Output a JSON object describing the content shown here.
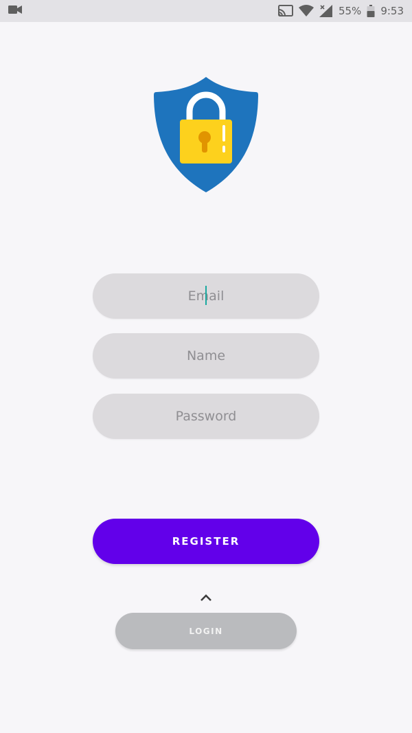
{
  "status_bar": {
    "left_icon": "video-camera-icon",
    "icons": [
      "cast-icon",
      "wifi-icon",
      "signal-icon",
      "battery-icon"
    ],
    "battery": "55%",
    "time": "9:53"
  },
  "logo": {
    "icon": "shield-lock-icon",
    "colors": {
      "shield": "#1e74bd",
      "lock_body": "#fdd11d",
      "keyhole": "#e19400",
      "shackle": "#ffffff"
    }
  },
  "form": {
    "email_placeholder": "Email",
    "name_placeholder": "Name",
    "password_placeholder": "Password"
  },
  "buttons": {
    "register_label": "REGISTER",
    "login_label": "LOGIN",
    "chevron_icon": "chevron-up-icon"
  },
  "colors": {
    "accent": "#6200ea",
    "field_bg": "#dcdadd",
    "login_bg": "#babbbe",
    "cursor": "#1aa9a0"
  }
}
